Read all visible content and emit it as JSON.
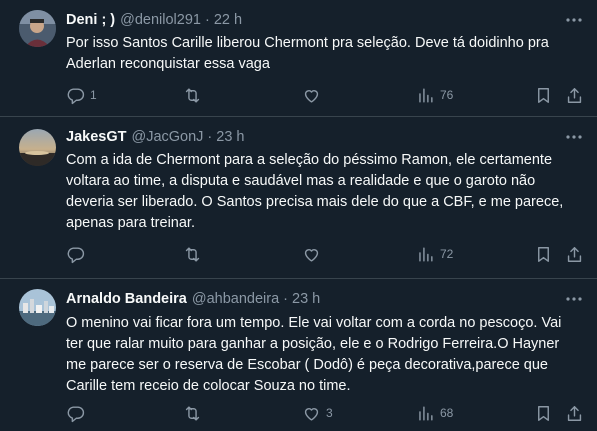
{
  "tweets": [
    {
      "name": "Deni ; )",
      "handle": "@denilol291",
      "separator": "·",
      "time": "22 h",
      "text": "Por isso Santos Carille liberou Chermont pra seleção. Deve tá doidinho pra Aderlan reconquistar essa vaga",
      "replies": "1",
      "retweets": "",
      "likes": "",
      "views": "76",
      "avatar_icon": "avatar-photo-person"
    },
    {
      "name": "JakesGT",
      "handle": "@JacGonJ",
      "separator": "·",
      "time": "23 h",
      "text": "Com a ida de Chermont para a seleção do péssimo Ramon, ele certamente voltara ao time, a disputa e saudável  mas a realidade e que o garoto não deveria ser liberado. O Santos precisa mais dele do que a CBF, e me parece, apenas para treinar.",
      "replies": "",
      "retweets": "",
      "likes": "",
      "views": "72",
      "avatar_icon": "avatar-photo-sunset"
    },
    {
      "name": "Arnaldo Bandeira",
      "handle": "@ahbandeira",
      "separator": "·",
      "time": "23 h",
      "text": "O menino vai ficar fora um tempo. Ele vai voltar com a corda no pescoço. Vai ter que ralar muito para ganhar a posição, ele e o Rodrigo Ferreira.O Hayner me parece ser o reserva de Escobar ( Dodô) é peça decorativa,parece que Carille tem receio de colocar Souza no time.",
      "replies": "",
      "retweets": "",
      "likes": "3",
      "views": "68",
      "avatar_icon": "avatar-photo-city"
    }
  ],
  "icons": {
    "reply": "reply-icon",
    "retweet": "retweet-icon",
    "like": "heart-icon",
    "views": "views-chart-icon",
    "bookmark": "bookmark-icon",
    "share": "share-icon",
    "more": "more-dots-icon"
  },
  "colors": {
    "background": "#15202b",
    "text": "#f7f9f9",
    "secondary": "#8b98a5",
    "border": "#38444d"
  }
}
